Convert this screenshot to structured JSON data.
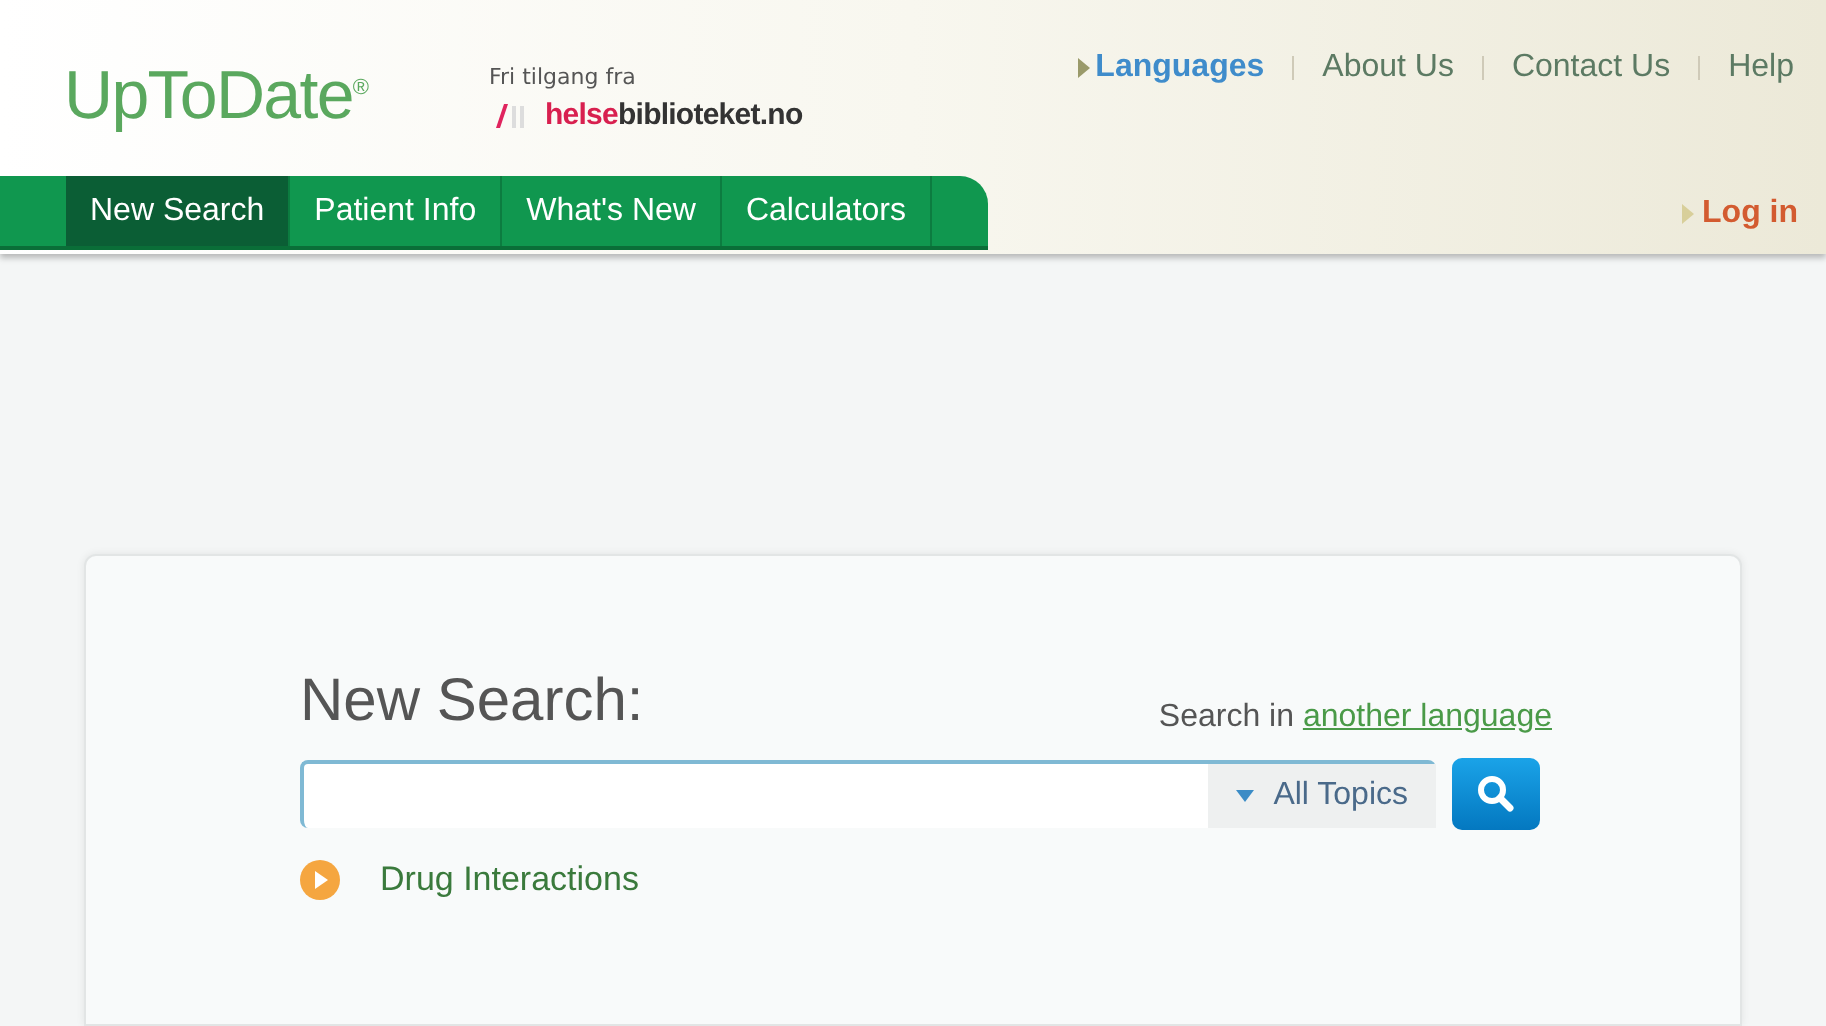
{
  "header": {
    "logo": "UpToDate",
    "logo_mark": "®",
    "sponsor": {
      "tagline": "Fri tilgang fra",
      "name_highlight": "helse",
      "name_rest": "biblioteket.no"
    },
    "top_links": [
      {
        "label": "Languages",
        "kind": "arrow"
      },
      {
        "label": "About Us",
        "kind": "plain"
      },
      {
        "label": "Contact Us",
        "kind": "plain"
      },
      {
        "label": "Help",
        "kind": "plain"
      }
    ],
    "tabs": [
      {
        "label": "New Search",
        "selected": true
      },
      {
        "label": "Patient Info",
        "selected": false
      },
      {
        "label": "What's New",
        "selected": false
      },
      {
        "label": "Calculators",
        "selected": false
      }
    ],
    "login": "Log in"
  },
  "search": {
    "title": "New Search:",
    "language_prefix": "Search in",
    "language_link": "another language",
    "topic_select": "All Topics",
    "link": "Drug Interactions"
  }
}
